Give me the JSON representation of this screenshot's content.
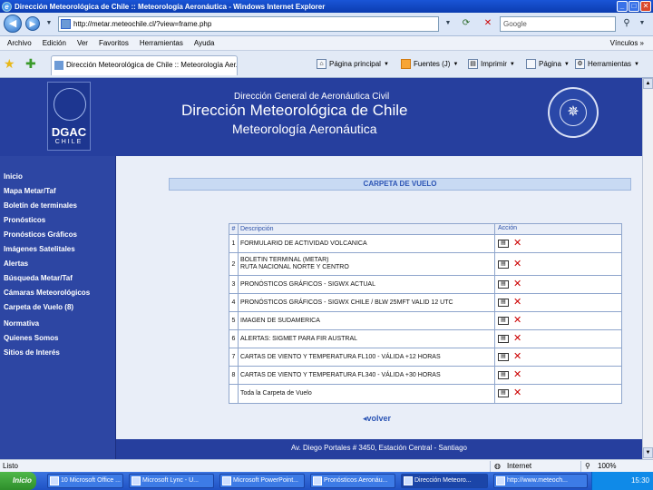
{
  "window": {
    "title": "Dirección Meteorológica de Chile :: Meteorología Aeronáutica - Windows Internet Explorer"
  },
  "toolbar": {
    "address": "http://metar.meteochile.cl/?view=frame.php",
    "search_placeholder": "Google"
  },
  "menu": {
    "items": [
      "Archivo",
      "Edición",
      "Ver",
      "Favoritos",
      "Herramientas",
      "Ayuda"
    ],
    "right": "Vínculos »"
  },
  "tabs": {
    "active_tab": "Dirección Meteorológica de Chile :: Meteorología Aer...",
    "commands": {
      "home": "Página principal",
      "feeds": "Fuentes (J)",
      "print": "Imprimir",
      "page": "Página",
      "tools": "Herramientas"
    }
  },
  "header": {
    "logo_text": "DGAC",
    "logo_subtext": "CHILE",
    "subtitle": "Dirección General de Aeronáutica Civil",
    "title": "Dirección Meteorológica de Chile",
    "section": "Meteorología Aeronáutica"
  },
  "sidebar": {
    "items": [
      "Inicio",
      "Mapa Metar/Taf",
      "Boletín de terminales",
      "Pronósticos",
      "Pronósticos Gráficos",
      "Imágenes Satelitales",
      "Alertas",
      "Búsqueda Metar/Taf",
      "Cámaras Meteorológicos",
      "Carpeta de Vuelo (8)",
      "Normativa",
      "Quienes Somos",
      "Sitios de Interés"
    ]
  },
  "main": {
    "section_title": "CARPETA DE VUELO",
    "table": {
      "col_num": "#",
      "col_desc": "Descripción",
      "col_action": "Acción",
      "rows": [
        {
          "num": "1",
          "desc": "FORMULARIO DE ACTIVIDAD VOLCANICA",
          "desc2": ""
        },
        {
          "num": "2",
          "desc": "BOLETIN TERMINAL (METAR)",
          "desc2": "RUTA NACIONAL NORTE Y CENTRO"
        },
        {
          "num": "3",
          "desc": "PRONÓSTICOS GRÁFICOS - SIGWX ACTUAL",
          "desc2": ""
        },
        {
          "num": "4",
          "desc": "PRONÓSTICOS GRÁFICOS - SIGWX CHILE / BLW 25MFT VALID 12 UTC",
          "desc2": ""
        },
        {
          "num": "5",
          "desc": "IMAGEN DE SUDAMERICA",
          "desc2": ""
        },
        {
          "num": "6",
          "desc": "ALERTAS: SIGMET PARA FIR AUSTRAL",
          "desc2": ""
        },
        {
          "num": "7",
          "desc": "CARTAS DE VIENTO Y TEMPERATURA FL100 - VÁLIDA +12 HORAS",
          "desc2": ""
        },
        {
          "num": "8",
          "desc": "CARTAS DE VIENTO Y TEMPERATURA FL340 - VÁLIDA +30 HORAS",
          "desc2": ""
        }
      ],
      "total_row": "Toda la Carpeta de Vuelo"
    },
    "back_link": "volver",
    "footer": "Av. Diego Portales # 3450, Estación Central - Santiago"
  },
  "status": {
    "text": "Listo",
    "zone": "Internet",
    "zoom": "100%"
  },
  "taskbar": {
    "start": "Inicio",
    "tasks": [
      "10 Microsoft Office ...",
      "Microsoft Lync - U...",
      "Microsoft PowerPoint...",
      "Pronósticos Aeronáu...",
      "Dirección Meteoro...",
      "http://www.meteoch..."
    ],
    "clock": "15:30"
  }
}
